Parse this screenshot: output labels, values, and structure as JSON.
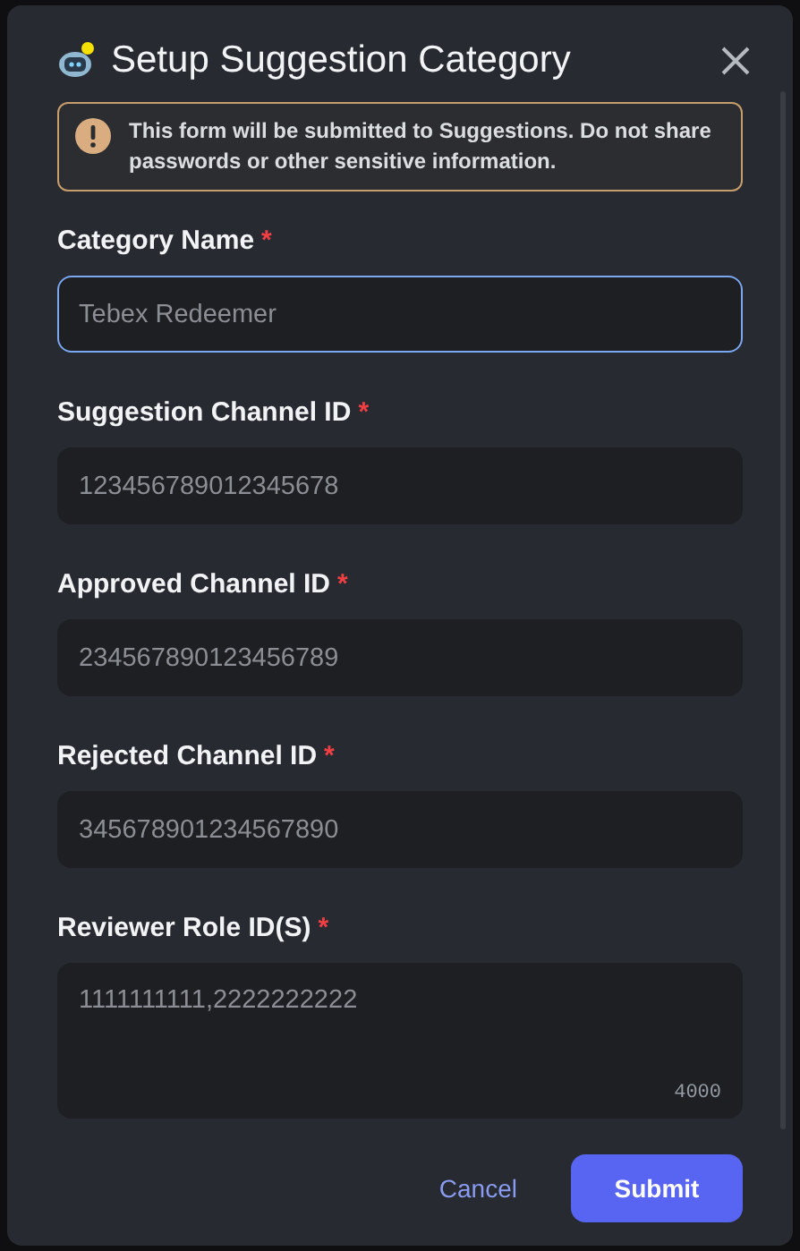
{
  "modal": {
    "title": "Setup Suggestion Category",
    "notice": "This form will be submitted to **Suggestions**. Do not share passwords or other sensitive information.",
    "fields": [
      {
        "kind": "input",
        "label": "Category Name",
        "required_mark": "*",
        "placeholder": "Tebex Redeemer",
        "focused": true
      },
      {
        "kind": "input",
        "label": "Suggestion Channel ID",
        "required_mark": "*",
        "placeholder": "123456789012345678",
        "focused": false
      },
      {
        "kind": "input",
        "label": "Approved Channel ID",
        "required_mark": "*",
        "placeholder": "234567890123456789",
        "focused": false
      },
      {
        "kind": "input",
        "label": "Rejected Channel ID",
        "required_mark": "*",
        "placeholder": "345678901234567890",
        "focused": false
      },
      {
        "kind": "textarea",
        "label": "Reviewer Role ID(S)",
        "required_mark": "*",
        "placeholder": "1111111111,2222222222",
        "focused": false,
        "counter": "4000"
      }
    ],
    "buttons": [
      {
        "kind": "link",
        "label": "Cancel"
      },
      {
        "kind": "primary",
        "label": "Submit"
      }
    ]
  }
}
